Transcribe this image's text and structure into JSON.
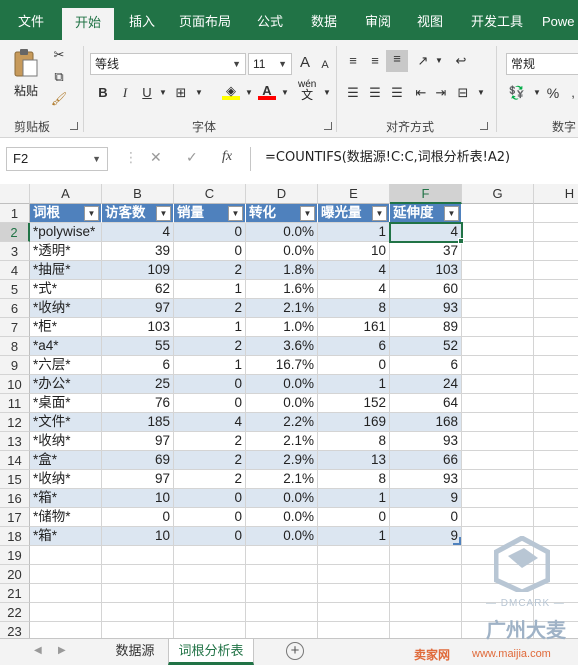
{
  "ribbon_tabs": [
    "文件",
    "开始",
    "插入",
    "页面布局",
    "公式",
    "数据",
    "审阅",
    "视图",
    "开发工具",
    "Powe"
  ],
  "active_tab": "开始",
  "clipboard": {
    "paste_label": "粘贴",
    "group_label": "剪贴板"
  },
  "font": {
    "name": "等线",
    "size": "11",
    "group_label": "字体",
    "bold": "B",
    "italic": "I",
    "underline": "U",
    "grow": "A",
    "shrink": "A",
    "phonetic_top": "wén",
    "phonetic_bottom": "文"
  },
  "alignment": {
    "group_label": "对齐方式"
  },
  "number": {
    "format": "常规",
    "group_label": "数字",
    "percent": "%"
  },
  "formula_bar": {
    "name_box": "F2",
    "cancel": "✕",
    "enter": "✓",
    "fx": "fx",
    "formula": "=COUNTIFS(数据源!C:C,词根分析表!A2)"
  },
  "columns": [
    "A",
    "B",
    "C",
    "D",
    "E",
    "F",
    "G",
    "H"
  ],
  "row_numbers": [
    "1",
    "2",
    "3",
    "4",
    "5",
    "6",
    "7",
    "8",
    "9",
    "10",
    "11",
    "12",
    "13",
    "14",
    "15",
    "16",
    "17",
    "18",
    "19",
    "20",
    "21",
    "22",
    "23"
  ],
  "table": {
    "headers": [
      "词根",
      "访客数",
      "销量",
      "转化",
      "曝光量",
      "延伸度"
    ],
    "rows": [
      [
        "*polywise*",
        "4",
        "0",
        "0.0%",
        "1",
        "4"
      ],
      [
        "*透明*",
        "39",
        "0",
        "0.0%",
        "10",
        "37"
      ],
      [
        "*抽屉*",
        "109",
        "2",
        "1.8%",
        "4",
        "103"
      ],
      [
        "*式*",
        "62",
        "1",
        "1.6%",
        "4",
        "60"
      ],
      [
        "*收纳*",
        "97",
        "2",
        "2.1%",
        "8",
        "93"
      ],
      [
        "*柜*",
        "103",
        "1",
        "1.0%",
        "161",
        "89"
      ],
      [
        "*a4*",
        "55",
        "2",
        "3.6%",
        "6",
        "52"
      ],
      [
        "*六层*",
        "6",
        "1",
        "16.7%",
        "0",
        "6"
      ],
      [
        "*办公*",
        "25",
        "0",
        "0.0%",
        "1",
        "24"
      ],
      [
        "*桌面*",
        "76",
        "0",
        "0.0%",
        "152",
        "64"
      ],
      [
        "*文件*",
        "185",
        "4",
        "2.2%",
        "169",
        "168"
      ],
      [
        "*收纳*",
        "97",
        "2",
        "2.1%",
        "8",
        "93"
      ],
      [
        "*盒*",
        "69",
        "2",
        "2.9%",
        "13",
        "66"
      ],
      [
        "*收纳*",
        "97",
        "2",
        "2.1%",
        "8",
        "93"
      ],
      [
        "*箱*",
        "10",
        "0",
        "0.0%",
        "1",
        "9"
      ],
      [
        "*储物*",
        "0",
        "0",
        "0.0%",
        "0",
        "0"
      ],
      [
        "*箱*",
        "10",
        "0",
        "0.0%",
        "1",
        "9"
      ]
    ]
  },
  "selected_cell": "F2",
  "sheets": [
    "数据源",
    "词根分析表"
  ],
  "active_sheet": "词根分析表",
  "watermark": {
    "brand": "— DMCARK —",
    "city": "广州大麦",
    "site_label": "卖家网",
    "site_url": "www.maijia.com"
  },
  "colors": {
    "ribbon_green": "#217346",
    "table_header": "#4f81bd",
    "table_band": "#dce6f1"
  }
}
